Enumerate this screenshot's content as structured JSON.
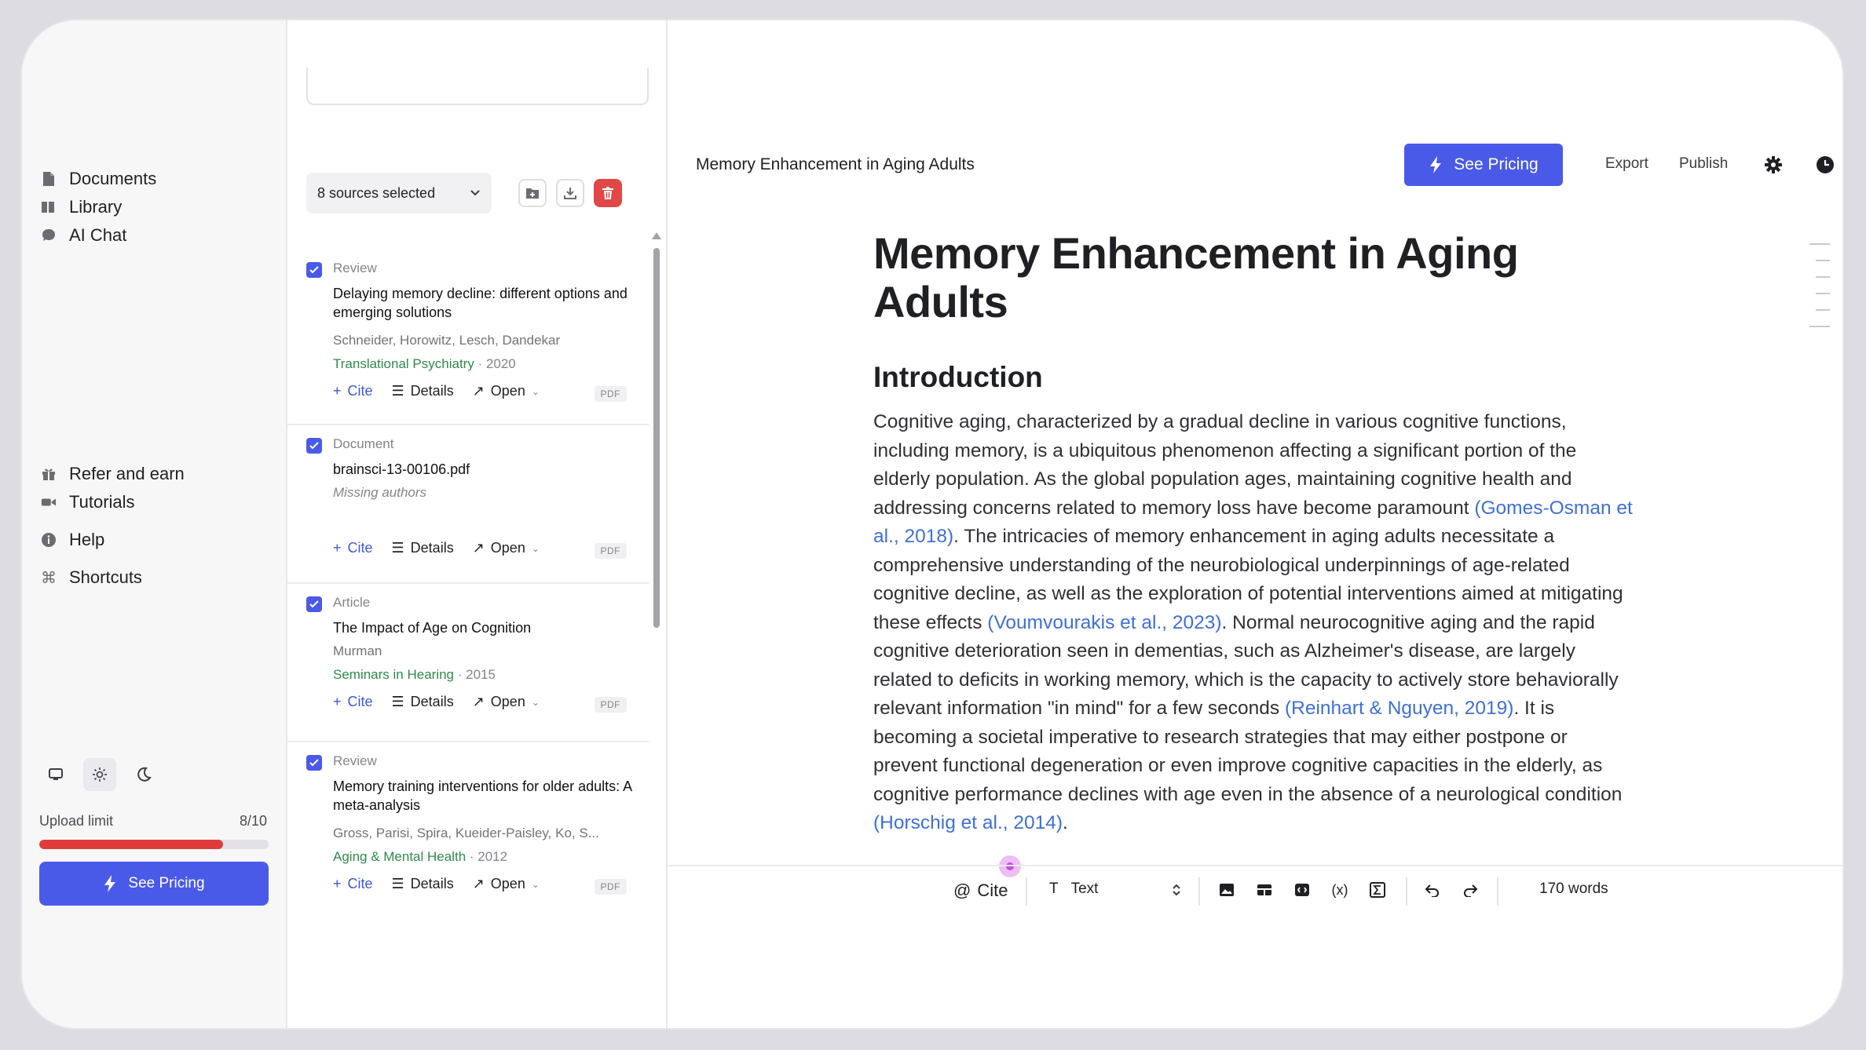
{
  "sidebar": {
    "nav": [
      {
        "label": "Documents",
        "icon": "document-icon"
      },
      {
        "label": "Library",
        "icon": "library-icon"
      },
      {
        "label": "AI Chat",
        "icon": "chat-bubble-icon"
      }
    ],
    "bottom_nav": [
      {
        "label": "Refer and earn",
        "icon": "gift-icon"
      },
      {
        "label": "Tutorials",
        "icon": "video-camera-icon"
      },
      {
        "label": "Help",
        "icon": "info-circle-icon"
      },
      {
        "label": "Shortcuts",
        "icon": "command-icon"
      }
    ],
    "theme_active": "light",
    "upload_limit_label": "Upload limit",
    "upload_limit_count": "8/10",
    "upload_fraction": 0.8,
    "see_pricing": "See Pricing"
  },
  "sources": {
    "selected_label": "8 sources selected",
    "cards": [
      {
        "type": "Review",
        "title": "Delaying memory decline: different options and emerging solutions",
        "authors": "Schneider, Horowitz, Lesch, Dandekar",
        "journal": "Translational Psychiatry",
        "year": "· 2020",
        "cite": "Cite",
        "details": "Details",
        "open": "Open",
        "badge": "PDF"
      },
      {
        "type": "Document",
        "title": "brainsci-13-00106.pdf",
        "missing": "Missing authors",
        "cite": "Cite",
        "details": "Details",
        "open": "Open",
        "badge": "PDF"
      },
      {
        "type": "Article",
        "title": "The Impact of Age on Cognition",
        "authors": "Murman",
        "journal": "Seminars in Hearing",
        "year": "· 2015",
        "cite": "Cite",
        "details": "Details",
        "open": "Open",
        "badge": "PDF"
      },
      {
        "type": "Review",
        "title": "Memory training interventions for older adults: A meta-analysis",
        "authors": "Gross, Parisi, Spira, Kueider-Paisley, Ko, S...",
        "journal": "Aging & Mental Health",
        "year": "· 2012",
        "cite": "Cite",
        "details": "Details",
        "open": "Open",
        "badge": "PDF"
      }
    ]
  },
  "editor": {
    "doc_title": "Memory Enhancement in Aging Adults",
    "see_pricing": "See Pricing",
    "export": "Export",
    "publish": "Publish",
    "heading": "Memory Enhancement in Aging Adults",
    "section": "Introduction",
    "paragraph": [
      {
        "t": "Cognitive aging, characterized by a gradual decline in various cognitive functions, including memory, is a ubiquitous phenomenon affecting a significant portion of the elderly population. As the global population ages, maintaining cognitive health and addressing concerns related to memory loss have become paramount "
      },
      {
        "t": "(Gomes-Osman et al., 2018)",
        "cite": true
      },
      {
        "t": ". The intricacies of memory enhancement in aging adults necessitate a comprehensive understanding of the neurobiological underpinnings of age-related cognitive decline, as well as the exploration of potential interventions aimed at mitigating these effects "
      },
      {
        "t": "(Voumvourakis et al., 2023)",
        "cite": true
      },
      {
        "t": ". Normal neurocognitive aging and the rapid cognitive deterioration seen in dementias, such as Alzheimer's disease, are largely related to deficits in working memory, which is the capacity to actively store behaviorally relevant information \"in mind\" for a few seconds "
      },
      {
        "t": "(Reinhart & Nguyen, 2019)",
        "cite": true
      },
      {
        "t": ". It is becoming a societal imperative to research strategies that may either postpone or prevent functional degeneration or even improve cognitive capacities in the elderly, as cognitive performance declines with age even in the absence of a neurological condition "
      },
      {
        "t": "(Horschig et al., 2014)",
        "cite": true
      },
      {
        "t": "."
      }
    ],
    "toolbar": {
      "cite": "Cite",
      "block_type": "Text",
      "word_count": "170 words"
    },
    "colors": {
      "accent": "#4a5ae8",
      "citation": "#3f6fd8",
      "journal": "#2f8a4a",
      "danger": "#e34646"
    }
  }
}
